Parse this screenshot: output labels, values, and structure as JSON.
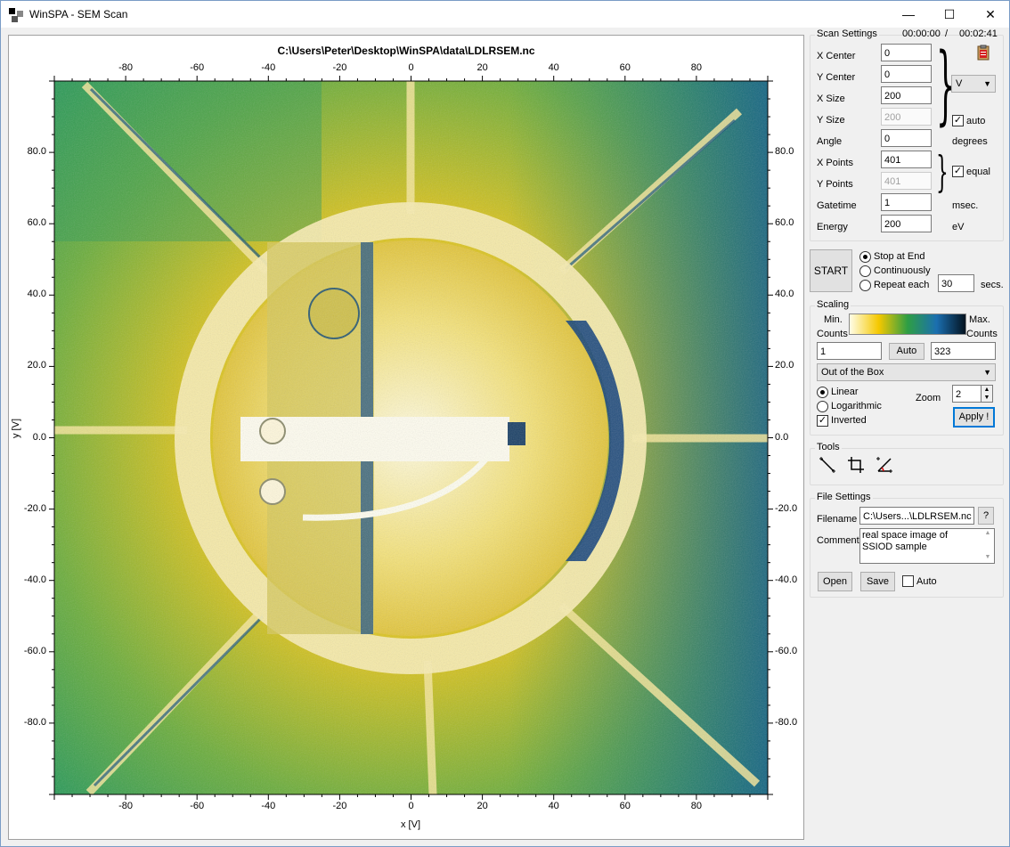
{
  "window": {
    "title": "WinSPA - SEM Scan",
    "minimize": "—",
    "maximize": "☐",
    "close": "✕"
  },
  "plot": {
    "title": "C:\\Users\\Peter\\Desktop\\WinSPA\\data\\LDLRSEM.nc",
    "x_ticks": [
      "-80",
      "-60",
      "-40",
      "-20",
      "0",
      "20",
      "40",
      "60",
      "80"
    ],
    "y_ticks": [
      "80.0",
      "60.0",
      "40.0",
      "20.0",
      "0.0",
      "-20.0",
      "-40.0",
      "-60.0",
      "-80.0"
    ],
    "xlabel": "x [V]",
    "ylabel": "y [V]"
  },
  "scan_settings": {
    "title": "Scan Settings",
    "elapsed": "00:00:00",
    "sep": "/",
    "total": "00:02:41",
    "x_center_label": "X Center",
    "x_center": "0",
    "y_center_label": "Y Center",
    "y_center": "0",
    "x_size_label": "X Size",
    "x_size": "200",
    "y_size_label": "Y Size",
    "y_size": "200",
    "unit": "V",
    "auto_label": "auto",
    "angle_label": "Angle",
    "angle": "0",
    "angle_unit": "degrees",
    "x_points_label": "X Points",
    "x_points": "401",
    "y_points_label": "Y Points",
    "y_points": "401",
    "equal_label": "equal",
    "gatetime_label": "Gatetime",
    "gatetime": "1",
    "gatetime_unit": "msec.",
    "energy_label": "Energy",
    "energy": "200",
    "energy_unit": "eV"
  },
  "run": {
    "start": "START",
    "stop_at_end": "Stop at End",
    "continuously": "Continuously",
    "repeat_each": "Repeat each",
    "repeat_value": "30",
    "repeat_unit": "secs."
  },
  "scaling": {
    "title": "Scaling",
    "min_label_1": "Min.",
    "min_label_2": "Counts",
    "max_label_1": "Max.",
    "max_label_2": "Counts",
    "min": "1",
    "auto": "Auto",
    "max": "323",
    "mode": "Out of the Box",
    "linear": "Linear",
    "logarithmic": "Logarithmic",
    "inverted": "Inverted",
    "zoom_label": "Zoom",
    "zoom": "2",
    "apply": "Apply !",
    "colors": [
      "#fffde8",
      "#f5c800",
      "#2e9e44",
      "#1b6fb0",
      "#03121f"
    ]
  },
  "tools": {
    "title": "Tools"
  },
  "file_settings": {
    "title": "File Settings",
    "filename_label": "Filename",
    "filename": "C:\\Users...\\LDLRSEM.nc",
    "browse": "?",
    "comment_label": "Comment",
    "comment": "real space image of SSIOD sample",
    "open": "Open",
    "save": "Save",
    "auto": "Auto"
  }
}
